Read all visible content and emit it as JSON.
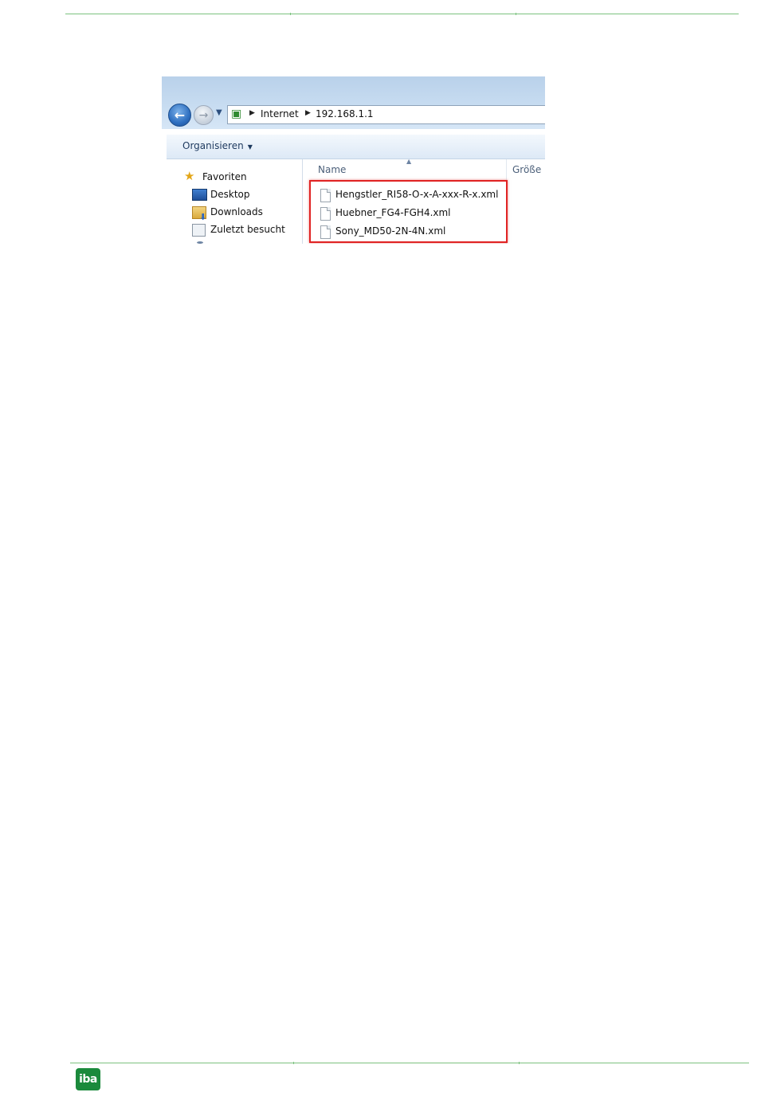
{
  "explorer": {
    "address_path": [
      "Internet",
      "192.168.1.1"
    ],
    "toolbar": {
      "organize_label": "Organisieren"
    },
    "sidebar": {
      "items": [
        {
          "label": "Favoriten",
          "icon": "star-icon"
        },
        {
          "label": "Desktop",
          "icon": "desktop-icon"
        },
        {
          "label": "Downloads",
          "icon": "downloads-folder-icon"
        },
        {
          "label": "Zuletzt besucht",
          "icon": "recent-places-icon"
        }
      ]
    },
    "columns": {
      "name": "Name",
      "size": "Größe"
    },
    "files": [
      "Hengstler_RI58-O-x-A-xxx-R-x.xml",
      "Huebner_FG4-FGH4.xml",
      "Sony_MD50-2N-4N.xml"
    ],
    "highlight_color": "#e02323"
  },
  "footer": {
    "logo_text": "iba",
    "logo_color": "#1b8a3c"
  },
  "rule_color": "#7cc27f"
}
